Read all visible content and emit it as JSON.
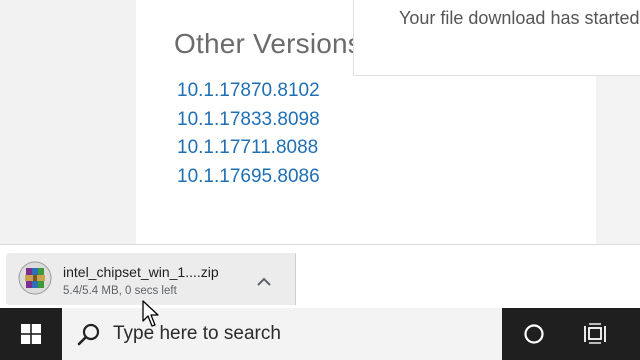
{
  "page": {
    "other_versions_title": "Other Versions",
    "versions": [
      "10.1.17870.8102",
      "10.1.17833.8098",
      "10.1.17711.8088",
      "10.1.17695.8086"
    ],
    "toast_text": "Your file download has started",
    "link_color": "#1f6fb5"
  },
  "download": {
    "file_name": "intel_chipset_win_1....zip",
    "status": "5.4/5.4 MB, 0 secs left",
    "icon": "winrar-archive-icon"
  },
  "taskbar": {
    "search_placeholder": "Type here to search",
    "icons": [
      "windows-start-icon",
      "search-icon",
      "cortana-icon",
      "task-view-icon"
    ],
    "background": "#1f1f1f"
  }
}
